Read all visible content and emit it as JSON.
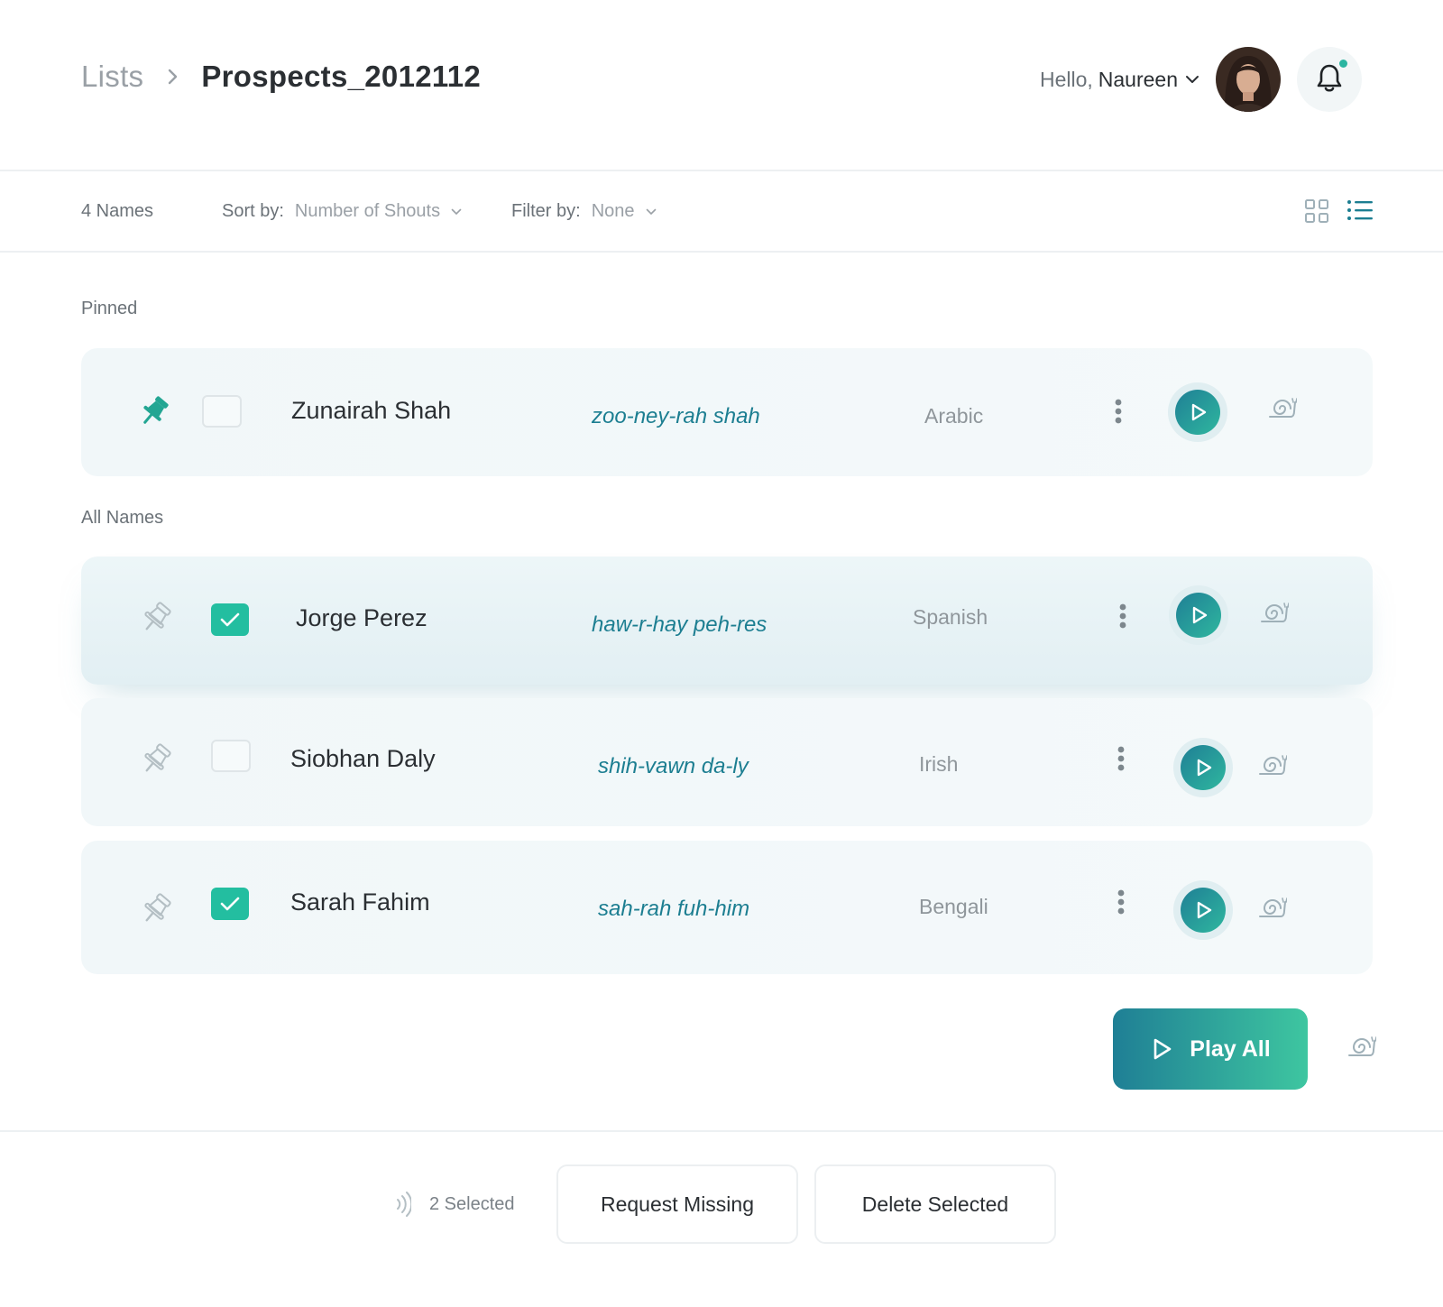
{
  "header": {
    "breadcrumb_root": "Lists",
    "breadcrumb_current": "Prospects_2012112",
    "greeting": "Hello,",
    "user_name": "Naureen"
  },
  "toolbar": {
    "count": "4 Names",
    "sort_label": "Sort by:",
    "sort_value": "Number of Shouts",
    "filter_label": "Filter by:",
    "filter_value": "None"
  },
  "sections": {
    "pinned": "Pinned",
    "all": "All Names"
  },
  "pinned_rows": [
    {
      "name": "Zunairah Shah",
      "phonetic": "zoo-ney-rah shah",
      "language": "Arabic",
      "pinned": true,
      "checked": false
    }
  ],
  "rows": [
    {
      "name": "Jorge Perez",
      "phonetic": "haw-r-hay peh-res",
      "language": "Spanish",
      "pinned": false,
      "checked": true
    },
    {
      "name": "Siobhan Daly",
      "phonetic": "shih-vawn da-ly",
      "language": "Irish",
      "pinned": false,
      "checked": false
    },
    {
      "name": "Sarah Fahim",
      "phonetic": "sah-rah fuh-him",
      "language": "Bengali",
      "pinned": false,
      "checked": true
    }
  ],
  "actions": {
    "play_all": "Play All",
    "selected": "2 Selected",
    "request_missing": "Request Missing",
    "delete_selected": "Delete Selected"
  },
  "colors": {
    "accent": "#23bea0",
    "teal_dark": "#1f7f95",
    "phonetic": "#1c7e91"
  },
  "icons": {
    "pin": "pin-icon",
    "play": "play-icon",
    "slow": "snail-icon",
    "more": "kebab-icon",
    "bell": "bell-icon"
  }
}
